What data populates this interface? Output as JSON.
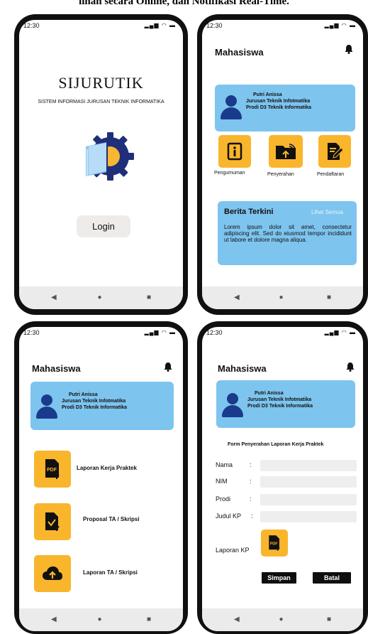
{
  "caption": "linan secara Online, dan Notifikasi Real-Time.",
  "status": {
    "time": "12:30",
    "icons": "▂▄▆ ◠ ▬"
  },
  "nav": {
    "back": "◀",
    "home": "●",
    "recent": "■"
  },
  "splash": {
    "title": "SIJURUTIK",
    "subtitle": "SISTEM INFORMASI JURUSAN TEKNIK INFORMATIKA",
    "login_button": "Login"
  },
  "dashboard": {
    "header": "Mahasiswa",
    "profile": {
      "name": "Putri Anissa",
      "department": "Jurusan Teknik Infotmatika",
      "program": "Prodi D3 Teknik Informatika"
    },
    "menu": [
      {
        "label": "Pengumuman",
        "icon": "info-icon"
      },
      {
        "label": "Penyerahan",
        "icon": "folder-upload-icon"
      },
      {
        "label": "Pendaftaran",
        "icon": "edit-document-icon"
      }
    ],
    "news": {
      "title": "Berita Terkini",
      "link": "Lihat Semua",
      "body": "Lorem ipsum dolor sit amet, consectetur adipiscing elit. Sed do eiusmod tempor incididunt ut labore et dolore magna aliqua."
    }
  },
  "submission": {
    "header": "Mahasiswa",
    "profile": {
      "name": "Putri Anissa",
      "department": "Jurusan Teknik Infotmatika",
      "program": "Prodi D3 Teknik Informatika"
    },
    "items": [
      {
        "label": "Laporan Kerja Praktek",
        "icon": "pdf-upload-icon"
      },
      {
        "label": "Proposal TA / Skripsi",
        "icon": "document-upload-icon"
      },
      {
        "label": "Laporan TA / Skripsi",
        "icon": "cloud-upload-icon"
      }
    ]
  },
  "form": {
    "header": "Mahasiswa",
    "profile": {
      "name": "Putri Anissa",
      "department": "Jurusan Teknik Infotmatika",
      "program": "Prodi D3 Teknik Informatika"
    },
    "title": "Form Penyerahan Laporan Kerja Praktek",
    "fields": [
      {
        "label": "Nama",
        "colon": ":",
        "value": ""
      },
      {
        "label": "NIM",
        "colon": ":",
        "value": ""
      },
      {
        "label": "Prodi",
        "colon": ":",
        "value": ""
      },
      {
        "label": "Judul KP",
        "colon": ":",
        "value": ""
      }
    ],
    "upload_label": "Laporan KP",
    "save_button": "Simpan",
    "cancel_button": "Batal"
  }
}
